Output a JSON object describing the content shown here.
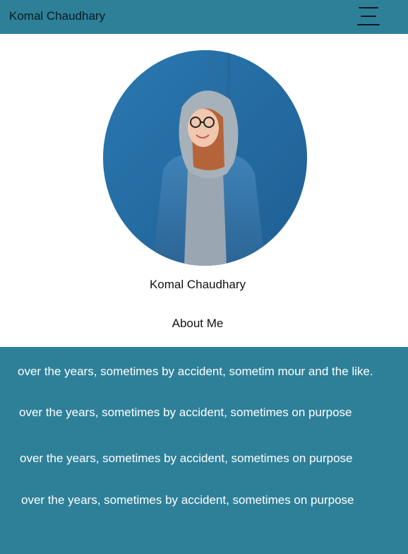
{
  "navbar": {
    "brand": "Komal Chaudhary",
    "menu_icon": "hamburger-menu-icon"
  },
  "profile": {
    "name": "Komal Chaudhary",
    "photo": "profile-photo"
  },
  "about": {
    "heading": "About Me",
    "lines": [
      "over the years, sometimes by accident, sometim mour and the like.",
      "over the years, sometimes by accident, sometimes on purpose",
      "over the years, sometimes by accident, sometimes on purpose",
      "over the years, sometimes by accident, sometimes on purpose"
    ]
  },
  "colors": {
    "accent": "#2e8099",
    "text_dark": "#0b1a20",
    "text_light": "#ffffff"
  }
}
